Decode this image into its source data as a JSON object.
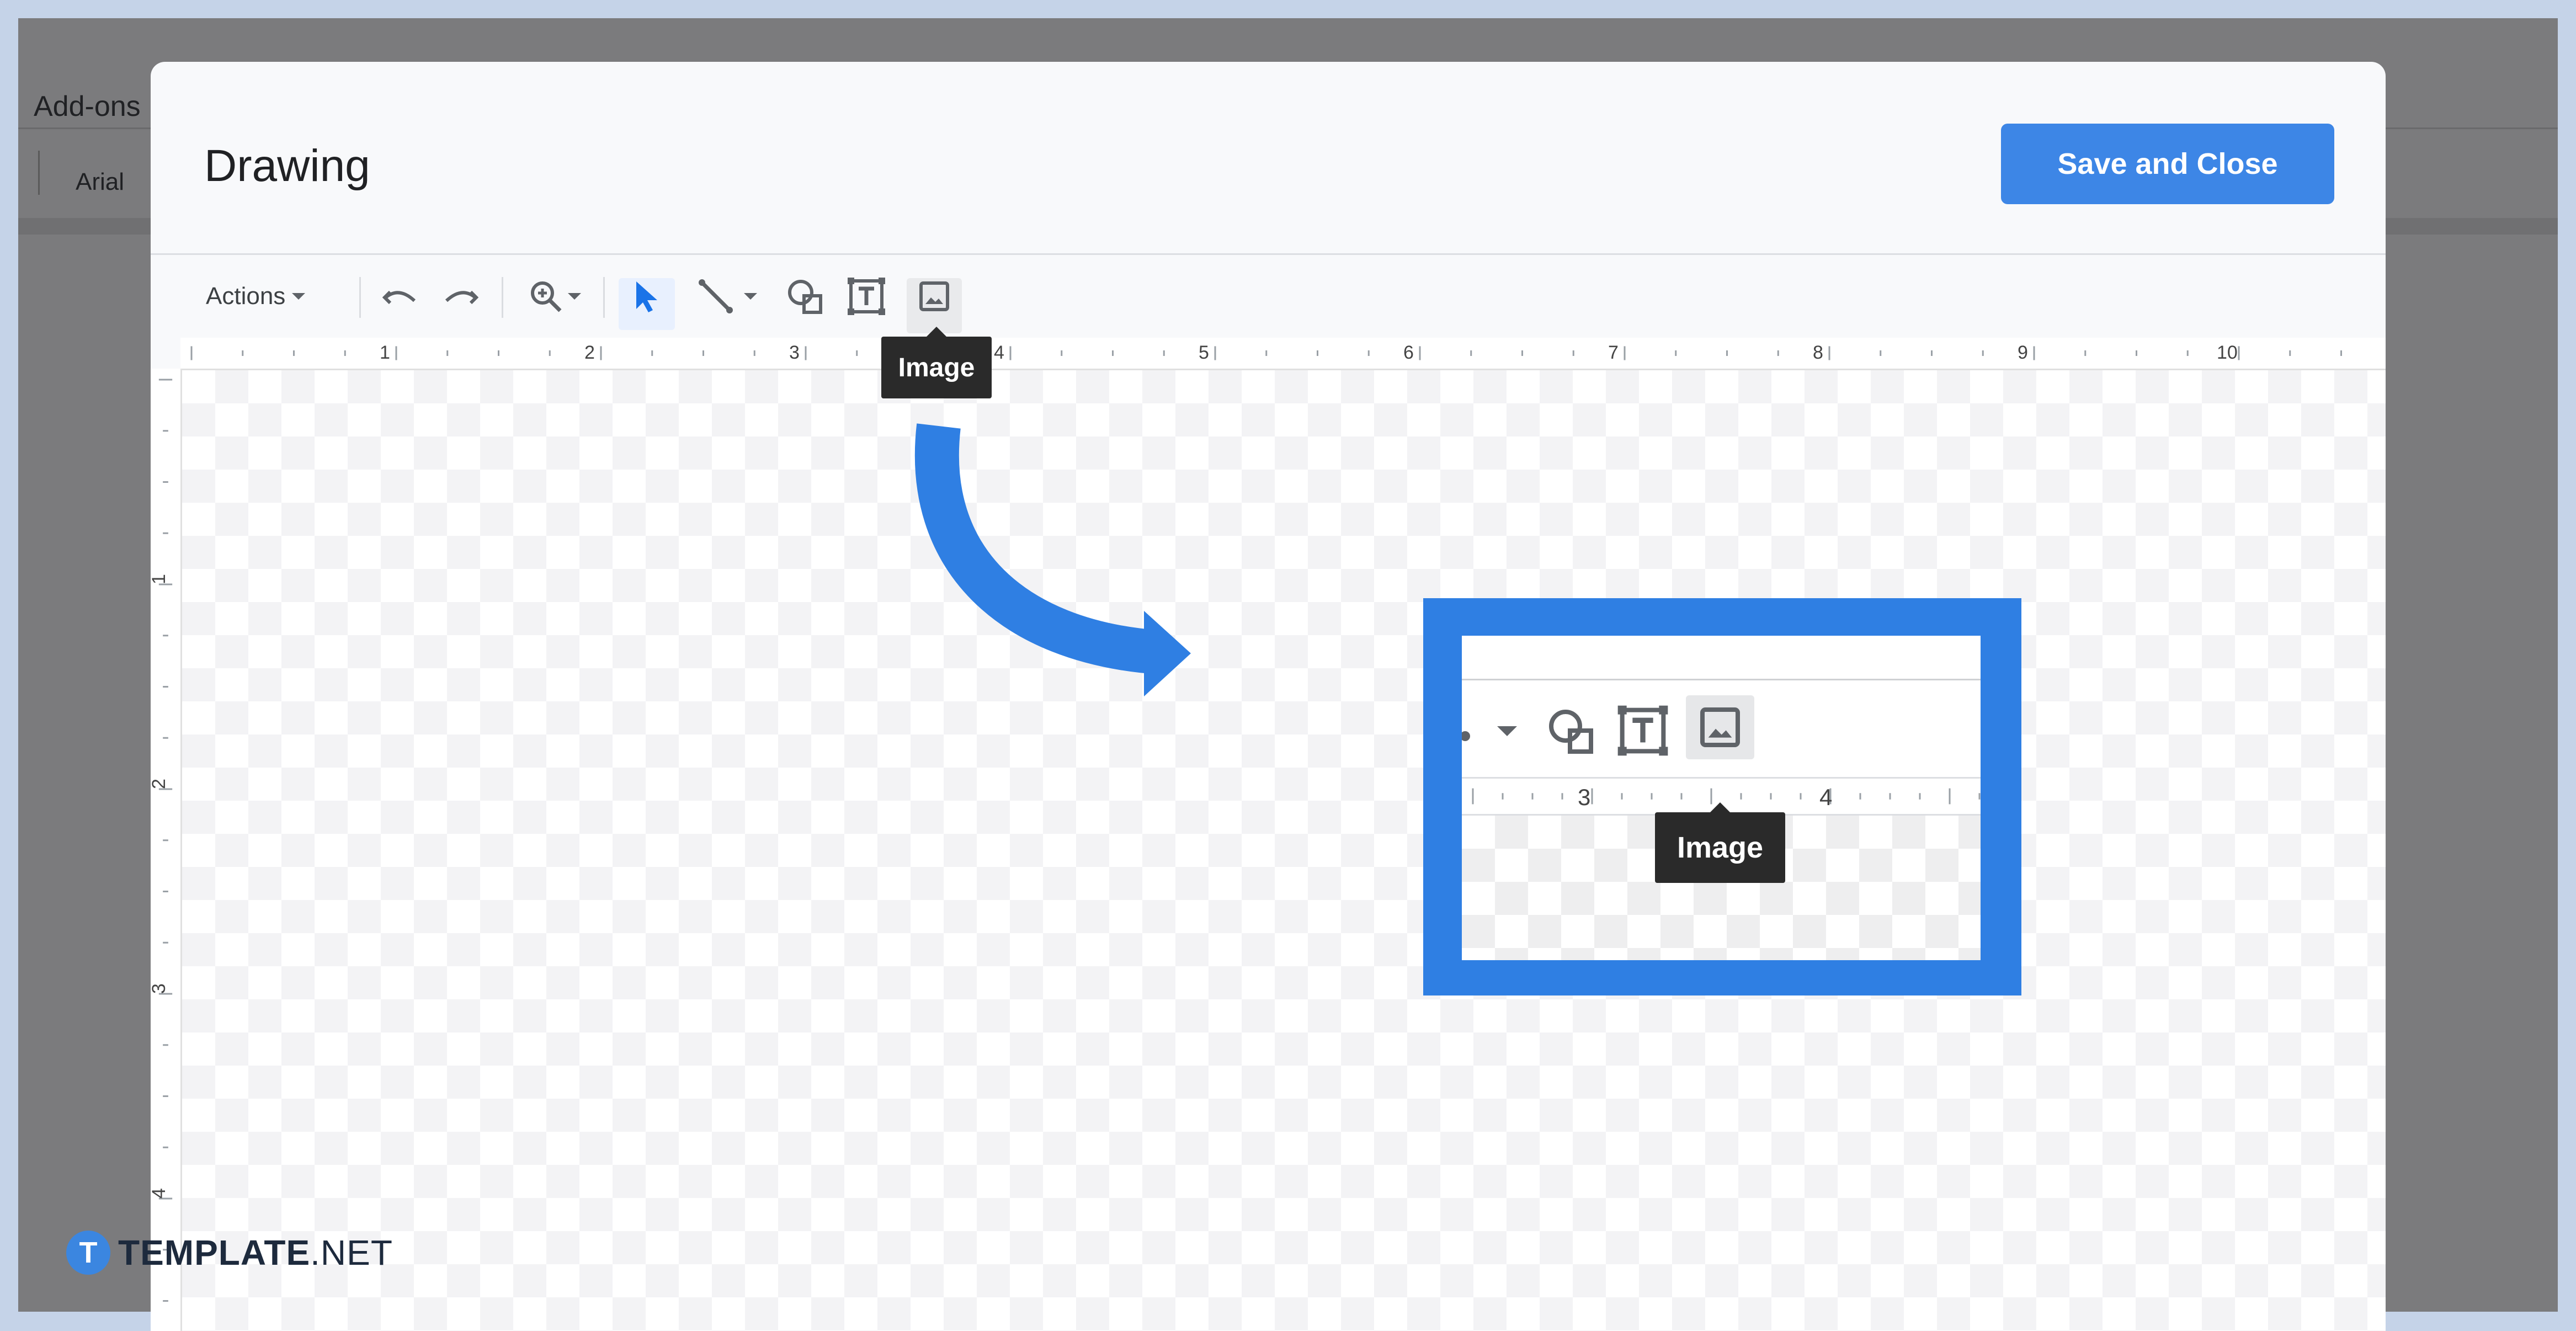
{
  "background": {
    "menu_item": "Add-ons",
    "font_name": "Arial"
  },
  "dialog": {
    "title": "Drawing",
    "save_button": "Save and Close"
  },
  "toolbar": {
    "actions_label": "Actions",
    "tooltip": "Image",
    "icons": [
      "undo-icon",
      "redo-icon",
      "zoom-icon",
      "select-icon",
      "line-icon",
      "shape-icon",
      "textbox-icon",
      "image-icon"
    ]
  },
  "ruler": {
    "horizontal": [
      "1",
      "2",
      "3",
      "4",
      "5",
      "6",
      "7",
      "8",
      "9",
      "10"
    ],
    "vertical": [
      "1",
      "2",
      "3",
      "4"
    ]
  },
  "zoom_callout": {
    "ruler_labels": [
      "3",
      "4"
    ],
    "tooltip": "Image"
  },
  "watermark": {
    "mark": "T",
    "brand_bold": "TEMPLATE",
    "brand_rest": ".NET"
  },
  "colors": {
    "accent": "#3d86e6",
    "callout": "#2f7fe3"
  }
}
